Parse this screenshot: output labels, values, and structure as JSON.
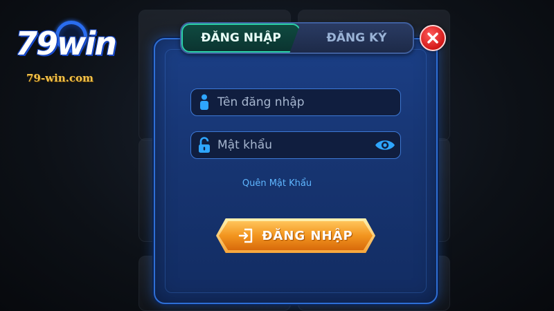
{
  "logo": {
    "brand": "79win",
    "domain": "79-win.com"
  },
  "tabs": [
    {
      "label": "ĐĂNG NHẬP",
      "active": true
    },
    {
      "label": "ĐĂNG KÝ",
      "active": false
    }
  ],
  "form": {
    "username_placeholder": "Tên đăng nhập",
    "password_placeholder": "Mật khẩu",
    "forgot_password": "Quên Mật Khẩu",
    "submit_label": "ĐĂNG NHẬP"
  },
  "icons": {
    "user": "user-icon",
    "lock": "lock-icon",
    "eye": "eye-icon",
    "close": "close-icon",
    "login": "login-icon"
  },
  "colors": {
    "tab_active": "#2bd1a8",
    "input_border": "#3d79d6",
    "icon_accent": "#2ea6ff",
    "button": "#f2951f",
    "close": "#d31818",
    "link": "#5fb6ff"
  }
}
